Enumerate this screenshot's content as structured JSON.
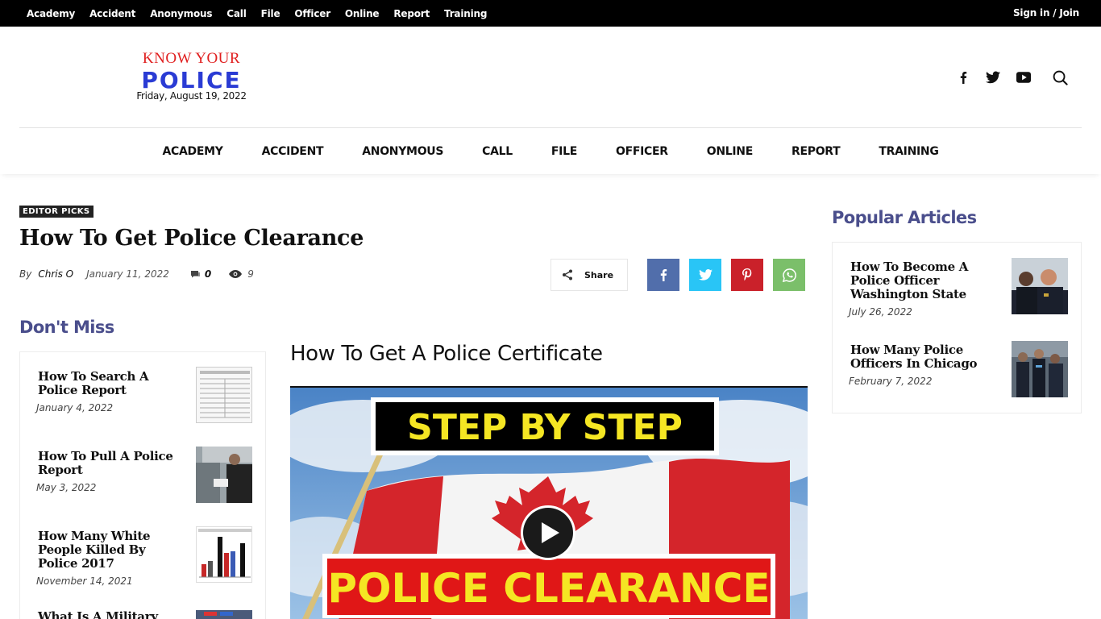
{
  "topbar": {
    "menu": [
      "Academy",
      "Accident",
      "Anonymous",
      "Call",
      "File",
      "Officer",
      "Online",
      "Report",
      "Training"
    ],
    "signin": "Sign in / Join"
  },
  "logo": {
    "line1": "KNOW YOUR",
    "line2": "POLICE",
    "date": "Friday, August 19, 2022"
  },
  "social": {
    "icons": [
      "facebook-icon",
      "twitter-icon",
      "youtube-icon",
      "search-icon"
    ]
  },
  "nav": [
    "ACADEMY",
    "ACCIDENT",
    "ANONYMOUS",
    "CALL",
    "FILE",
    "OFFICER",
    "ONLINE",
    "REPORT",
    "TRAINING"
  ],
  "article": {
    "badge": "EDITOR PICKS",
    "title": "How To Get Police Clearance",
    "by": "By",
    "author": "Chris O",
    "date": "January 11, 2022",
    "comments": "0",
    "views": "9",
    "share_label": "Share",
    "subhead": "How To Get A Police Certificate"
  },
  "share_buttons": [
    {
      "name": "facebook",
      "color": "#516eab"
    },
    {
      "name": "twitter",
      "color": "#29c5f6"
    },
    {
      "name": "pinterest",
      "color": "#ca212a"
    },
    {
      "name": "whatsapp",
      "color": "#7bbf6a"
    }
  ],
  "dont_miss": {
    "title": "Don't Miss",
    "items": [
      {
        "title": "How To Search A Police Report",
        "date": "January 4, 2022"
      },
      {
        "title": "How To Pull A Police Report",
        "date": "May 3, 2022"
      },
      {
        "title": "How Many White People Killed By Police 2017",
        "date": "November 14, 2021"
      },
      {
        "title": "What Is A Military",
        "date": ""
      }
    ]
  },
  "popular": {
    "title": "Popular Articles",
    "items": [
      {
        "title": "How To Become A Police Officer Washington State",
        "date": "July 26, 2022"
      },
      {
        "title": "How Many Police Officers In Chicago",
        "date": "February 7, 2022"
      }
    ]
  },
  "video": {
    "top_text": "STEP BY STEP",
    "bottom_text": "POLICE CLEARANCE"
  }
}
